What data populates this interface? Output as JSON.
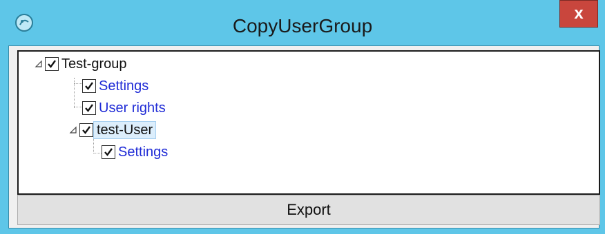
{
  "window": {
    "title": "CopyUserGroup",
    "close_label": "x"
  },
  "icons": {
    "app": "app-logo-icon",
    "close": "close-icon",
    "expanded": "collapse-triangle-icon",
    "checked": "checkmark-icon"
  },
  "tree": {
    "root": {
      "label": "Test-group",
      "checked": true,
      "expanded": true
    },
    "children": [
      {
        "label": "Settings",
        "checked": true
      },
      {
        "label": "User rights",
        "checked": true
      },
      {
        "label": "test-User",
        "checked": true,
        "expanded": true,
        "selected": true,
        "children": [
          {
            "label": "Settings",
            "checked": true
          }
        ]
      }
    ]
  },
  "actions": {
    "export_label": "Export"
  },
  "colors": {
    "titlebar": "#5ec6e8",
    "close": "#c9463d",
    "link": "#1f2bd6"
  }
}
